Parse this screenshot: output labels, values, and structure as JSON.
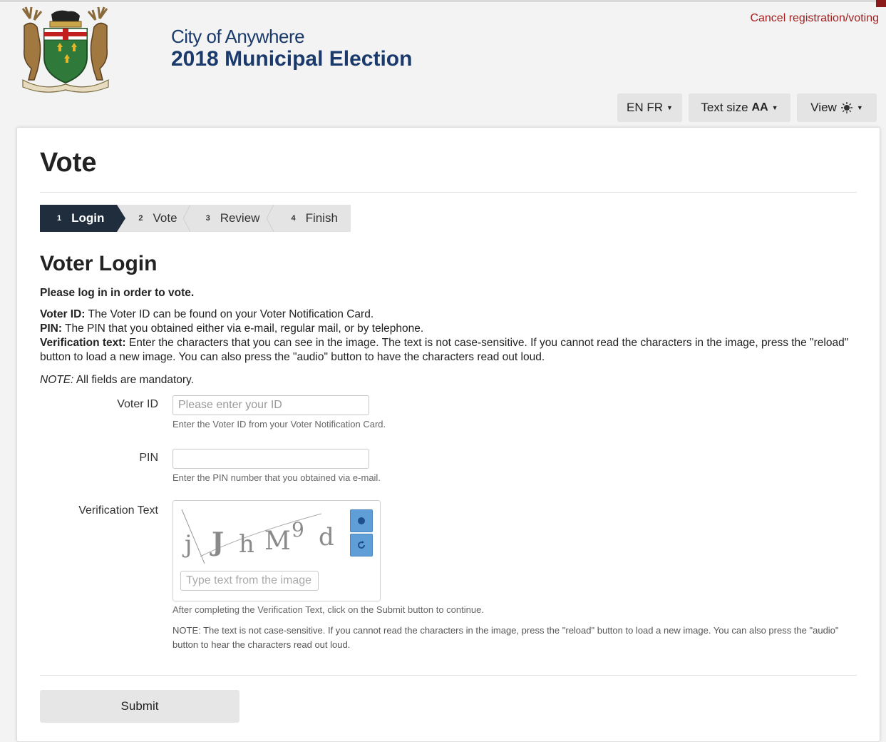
{
  "header": {
    "city": "City of Anywhere",
    "election": "2018 Municipal Election",
    "cancel_link": "Cancel registration/voting",
    "lang_button": "EN FR",
    "textsize_button": "Text size",
    "textsize_glyph": "AA",
    "view_button": "View"
  },
  "page": {
    "title": "Vote"
  },
  "steps": [
    {
      "num": "1",
      "label": "Login"
    },
    {
      "num": "2",
      "label": "Vote"
    },
    {
      "num": "3",
      "label": "Review"
    },
    {
      "num": "4",
      "label": "Finish"
    }
  ],
  "login": {
    "heading": "Voter Login",
    "intro": "Please log in in order to vote.",
    "voterid_term": "Voter ID:",
    "voterid_desc": " The Voter ID can be found on your Voter Notification Card.",
    "pin_term": "PIN:",
    "pin_desc": " The PIN that you obtained either via e-mail, regular mail, or by telephone.",
    "verif_term": "Verification text:",
    "verif_desc": " Enter the characters that you can see in the image. The text is not case-sensitive. If you cannot read the characters in the image, press the \"reload\" button to load a new image. You can also press the \"audio\" button to have the characters read out loud.",
    "note_label": "NOTE:",
    "note_text": " All fields are mandatory."
  },
  "form": {
    "voterid_label": "Voter ID",
    "voterid_placeholder": "Please enter your ID",
    "voterid_help": "Enter the Voter ID from your Voter Notification Card.",
    "pin_label": "PIN",
    "pin_help": "Enter the PIN number that you obtained via e-mail.",
    "verif_label": "Verification Text",
    "captcha_chars": [
      "j",
      "J",
      "h",
      "M",
      "9",
      "d"
    ],
    "captcha_placeholder": "Type text from the image",
    "verif_help": "After completing the Verification Text, click on the Submit button to continue.",
    "verif_note": "NOTE: The text is not case-sensitive. If you cannot read the characters in the image, press the \"reload\" button to load a new image. You can also press the \"audio\" button to hear the characters read out loud.",
    "submit_label": "Submit"
  },
  "colors": {
    "brand_navy": "#1a3a6b",
    "cancel_red": "#a41d1d",
    "step_active": "#1f2d3d",
    "captcha_button": "#5f9ed6"
  },
  "icons": {
    "audio": "audio-icon",
    "reload": "reload-icon",
    "view": "sun-icon",
    "dropdown": "caret-down-icon"
  }
}
